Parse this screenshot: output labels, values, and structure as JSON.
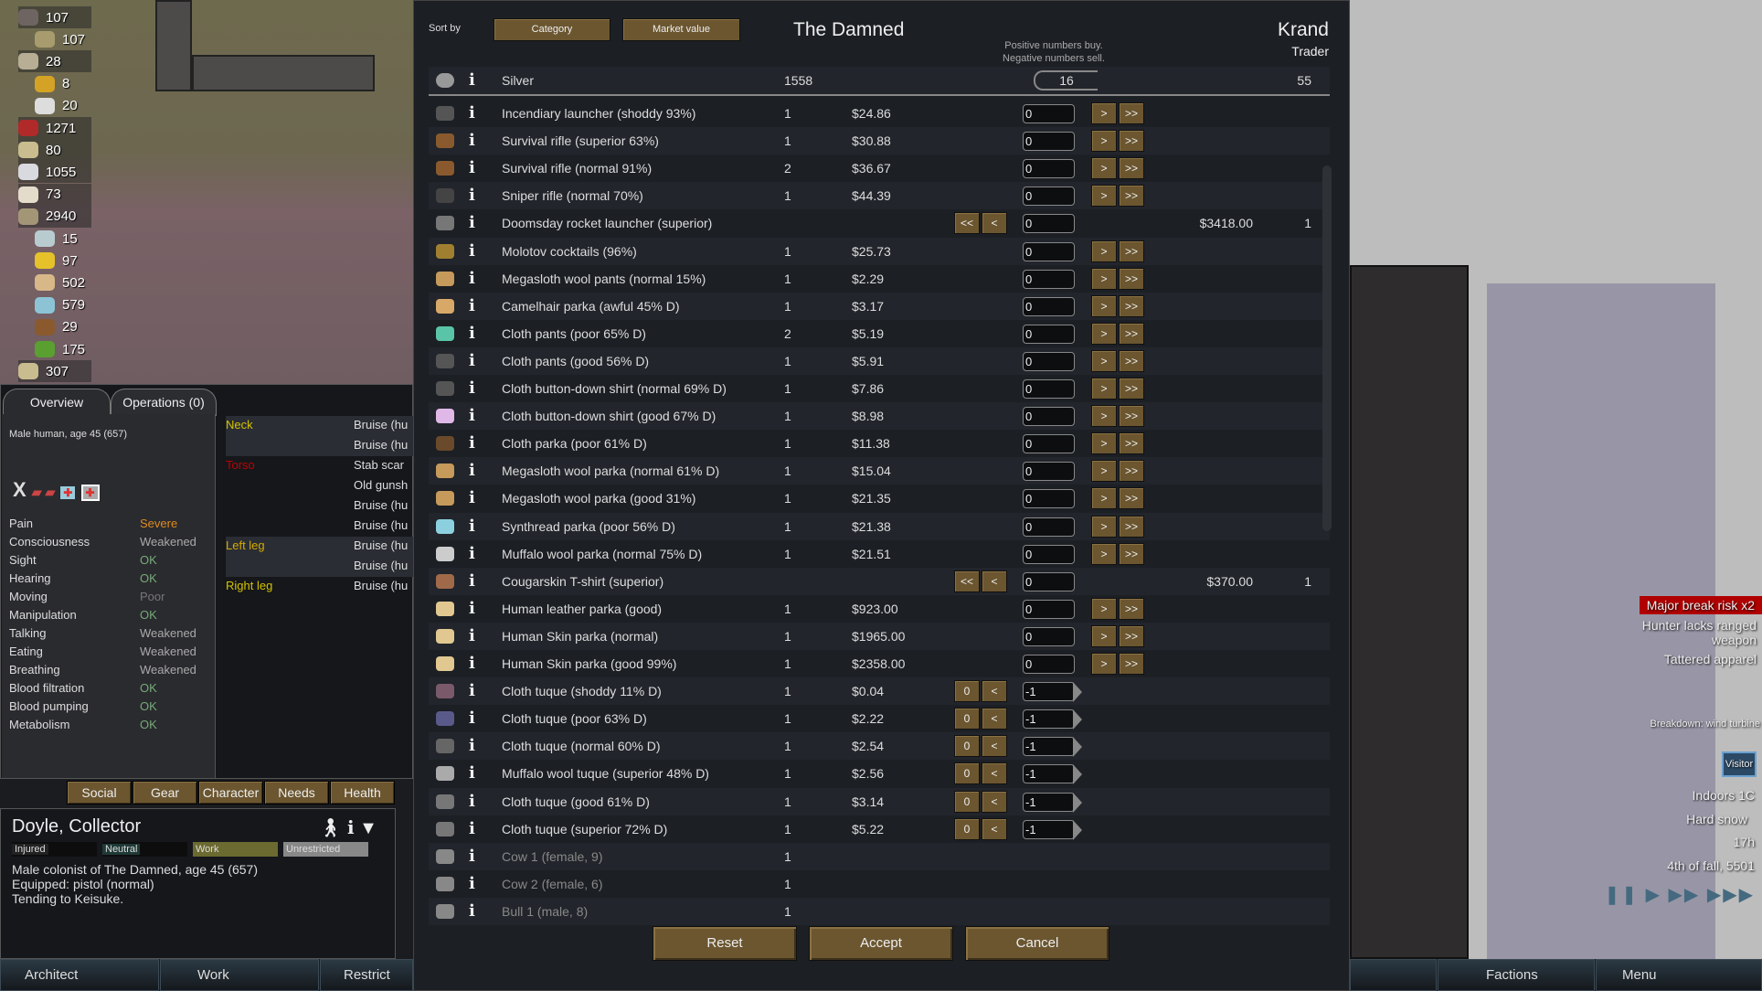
{
  "resources": [
    {
      "value": "107",
      "color": "#6e6462",
      "expanded": true
    },
    {
      "value": "107",
      "color": "#a89c6e",
      "sub": true
    },
    {
      "value": "28",
      "color": "#b7ae95",
      "expanded": true
    },
    {
      "value": "8",
      "color": "#d4a326",
      "sub": true
    },
    {
      "value": "20",
      "color": "#ddd",
      "sub": true
    },
    {
      "value": "1271",
      "color": "#b02a2a"
    },
    {
      "value": "80",
      "color": "#c9bc8e"
    },
    {
      "value": "1055",
      "color": "#d9d9e0"
    },
    {
      "value": "73",
      "color": "#e4dccb"
    },
    {
      "value": "2940",
      "color": "#a39677",
      "expanded": true
    },
    {
      "value": "15",
      "color": "#b8ccd0",
      "sub": true
    },
    {
      "value": "97",
      "color": "#e5c22a",
      "sub": true
    },
    {
      "value": "502",
      "color": "#d8b888",
      "sub": true
    },
    {
      "value": "579",
      "color": "#8cc4d6",
      "sub": true
    },
    {
      "value": "29",
      "color": "#8a5a2e",
      "sub": true
    },
    {
      "value": "175",
      "color": "#5aa030",
      "sub": true
    },
    {
      "value": "307",
      "color": "#c9bc8e",
      "expanded": true
    }
  ],
  "health": {
    "tabs": [
      "Overview",
      "Operations (0)"
    ],
    "summary": "Male human, age 45 (657)",
    "capacities": [
      {
        "name": "Pain",
        "value": "Severe",
        "color": "#e08a1e"
      },
      {
        "name": "Consciousness",
        "value": "Weakened",
        "color": "#aaaaaa"
      },
      {
        "name": "Sight",
        "value": "OK",
        "color": "#77aa77"
      },
      {
        "name": "Hearing",
        "value": "OK",
        "color": "#77aa77"
      },
      {
        "name": "Moving",
        "value": "Poor",
        "color": "#777777"
      },
      {
        "name": "Manipulation",
        "value": "OK",
        "color": "#77aa77"
      },
      {
        "name": "Talking",
        "value": "Weakened",
        "color": "#aaaaaa"
      },
      {
        "name": "Eating",
        "value": "Weakened",
        "color": "#aaaaaa"
      },
      {
        "name": "Breathing",
        "value": "Weakened",
        "color": "#aaaaaa"
      },
      {
        "name": "Blood filtration",
        "value": "OK",
        "color": "#77aa77"
      },
      {
        "name": "Blood pumping",
        "value": "OK",
        "color": "#77aa77"
      },
      {
        "name": "Metabolism",
        "value": "OK",
        "color": "#77aa77"
      }
    ],
    "parts": [
      {
        "part": "Neck",
        "color": "#d4c200",
        "injuries": [
          "Bruise (hu",
          "Bruise (hu"
        ]
      },
      {
        "part": "Torso",
        "color": "#c00000",
        "injuries": [
          "Stab scar",
          "Old gunsh",
          "Bruise (hu",
          "Bruise (hu"
        ]
      },
      {
        "part": "Left leg",
        "color": "#d4aa00",
        "injuries": [
          "Bruise (hu",
          "Bruise (hu"
        ]
      },
      {
        "part": "Right leg",
        "color": "#d4c200",
        "injuries": [
          "Bruise (hu"
        ]
      }
    ]
  },
  "inspect_tabs": [
    "Social",
    "Gear",
    "Character",
    "Needs",
    "Health"
  ],
  "pawn": {
    "name": "Doyle, Collector",
    "badges": [
      "Injured",
      "Neutral",
      "Work",
      "Unrestricted"
    ],
    "lines": [
      "Male colonist of The Damned, age 45 (657)",
      "Equipped: pistol (normal)",
      "Tending to Keisuke."
    ]
  },
  "bottom_left": [
    "Architect",
    "Work",
    "Restrict"
  ],
  "bottom_right": [
    "Factions",
    "Menu"
  ],
  "alerts": {
    "major": "Major break risk x2",
    "hunter": "Hunter lacks ranged weapon",
    "tattered": "Tattered apparel",
    "breakdown": "Breakdown: wind turbine",
    "visitor": "Visitor",
    "temp": "Indoors 1C",
    "weather": "Hard snow",
    "hour": "17h",
    "date": "4th of fall, 5501"
  },
  "trade": {
    "sort_label": "Sort by",
    "sort_buttons": [
      "Category",
      "Market value"
    ],
    "colony": "The Damned",
    "trader": "Krand",
    "trader_kind": "Trader",
    "hint1": "Positive numbers buy.",
    "hint2": "Negative numbers sell.",
    "silver": {
      "name": "Silver",
      "colony_count": "1558",
      "amount": "16",
      "trader_count": "55"
    },
    "rows": [
      {
        "name": "Incendiary launcher (shoddy 93%)",
        "count": "1",
        "price": "$24.86",
        "mode": "give",
        "amount": "0",
        "icon": "#555"
      },
      {
        "name": "Survival rifle (superior 63%)",
        "count": "1",
        "price": "$30.88",
        "mode": "give",
        "amount": "0",
        "icon": "#8a5a2e"
      },
      {
        "name": "Survival rifle (normal 91%)",
        "count": "2",
        "price": "$36.67",
        "mode": "give",
        "amount": "0",
        "icon": "#8a5a2e"
      },
      {
        "name": "Sniper rifle (normal 70%)",
        "count": "1",
        "price": "$44.39",
        "mode": "give",
        "amount": "0",
        "icon": "#444"
      },
      {
        "name": "Doomsday rocket launcher (superior)",
        "mode": "take",
        "amount": "0",
        "trader_price": "$3418.00",
        "trader_count": "1",
        "icon": "#777"
      },
      {
        "name": "Molotov cocktails (96%)",
        "count": "1",
        "price": "$25.73",
        "mode": "give",
        "amount": "0",
        "icon": "#a08030"
      },
      {
        "name": "Megasloth wool pants (normal 15%)",
        "count": "1",
        "price": "$2.29",
        "mode": "give",
        "amount": "0",
        "icon": "#c59a5a"
      },
      {
        "name": "Camelhair parka (awful 45% D)",
        "count": "1",
        "price": "$3.17",
        "mode": "give",
        "amount": "0",
        "icon": "#d8a868"
      },
      {
        "name": "Cloth pants (poor 65% D)",
        "count": "2",
        "price": "$5.19",
        "mode": "give",
        "amount": "0",
        "icon": "#5ac4a8"
      },
      {
        "name": "Cloth pants (good 56% D)",
        "count": "1",
        "price": "$5.91",
        "mode": "give",
        "amount": "0",
        "icon": "#555"
      },
      {
        "name": "Cloth button-down shirt (normal 69% D)",
        "count": "1",
        "price": "$7.86",
        "mode": "give",
        "amount": "0",
        "icon": "#555"
      },
      {
        "name": "Cloth button-down shirt (good 67% D)",
        "count": "1",
        "price": "$8.98",
        "mode": "give",
        "amount": "0",
        "icon": "#e0b8e8"
      },
      {
        "name": "Cloth parka (poor 61% D)",
        "count": "1",
        "price": "$11.38",
        "mode": "give",
        "amount": "0",
        "icon": "#6a4a2a"
      },
      {
        "name": "Megasloth wool parka (normal 61% D)",
        "count": "1",
        "price": "$15.04",
        "mode": "give",
        "amount": "0",
        "icon": "#c59a5a"
      },
      {
        "name": "Megasloth wool parka (good 31%)",
        "count": "1",
        "price": "$21.35",
        "mode": "give",
        "amount": "0",
        "icon": "#c59a5a"
      },
      {
        "name": "Synthread parka (poor 56% D)",
        "count": "1",
        "price": "$21.38",
        "mode": "give",
        "amount": "0",
        "icon": "#8cd0e0"
      },
      {
        "name": "Muffalo wool parka (normal 75% D)",
        "count": "1",
        "price": "$21.51",
        "mode": "give",
        "amount": "0",
        "icon": "#cccccc"
      },
      {
        "name": "Cougarskin T-shirt (superior)",
        "mode": "take",
        "amount": "0",
        "trader_price": "$370.00",
        "trader_count": "1",
        "icon": "#a06a4a"
      },
      {
        "name": "Human leather parka (good)",
        "count": "1",
        "price": "$923.00",
        "mode": "give",
        "amount": "0",
        "icon": "#e0c890"
      },
      {
        "name": "Human Skin parka (normal)",
        "count": "1",
        "price": "$1965.00",
        "mode": "give",
        "amount": "0",
        "icon": "#e0c890"
      },
      {
        "name": "Human Skin parka (good 99%)",
        "count": "1",
        "price": "$2358.00",
        "mode": "give",
        "amount": "0",
        "icon": "#e0c890"
      },
      {
        "name": "Cloth tuque (shoddy 11% D)",
        "count": "1",
        "price": "$0.04",
        "mode": "selling",
        "amount": "-1",
        "icon": "#7a5a6a"
      },
      {
        "name": "Cloth tuque (poor 63% D)",
        "count": "1",
        "price": "$2.22",
        "mode": "selling",
        "amount": "-1",
        "icon": "#5a5a8a"
      },
      {
        "name": "Cloth tuque (normal 60% D)",
        "count": "1",
        "price": "$2.54",
        "mode": "selling",
        "amount": "-1",
        "icon": "#666"
      },
      {
        "name": "Muffalo wool tuque (superior 48% D)",
        "count": "1",
        "price": "$2.56",
        "mode": "selling",
        "amount": "-1",
        "icon": "#aaa"
      },
      {
        "name": "Cloth tuque (good 61% D)",
        "count": "1",
        "price": "$3.14",
        "mode": "selling",
        "amount": "-1",
        "icon": "#777"
      },
      {
        "name": "Cloth tuque (superior 72% D)",
        "count": "1",
        "price": "$5.22",
        "mode": "selling",
        "amount": "-1",
        "icon": "#777"
      },
      {
        "name": "Cow 1 (female, 9)",
        "count": "1",
        "mode": "none",
        "icon": "#888"
      },
      {
        "name": "Cow 2 (female, 6)",
        "count": "1",
        "mode": "none",
        "icon": "#888"
      },
      {
        "name": "Bull 1 (male, 8)",
        "count": "1",
        "mode": "none",
        "icon": "#888"
      }
    ],
    "buttons": {
      "reset": "Reset",
      "accept": "Accept",
      "cancel": "Cancel"
    },
    "labels": {
      "give": ">",
      "give_all": ">>",
      "take": "<",
      "take_all": "<<",
      "zero": "0"
    }
  }
}
